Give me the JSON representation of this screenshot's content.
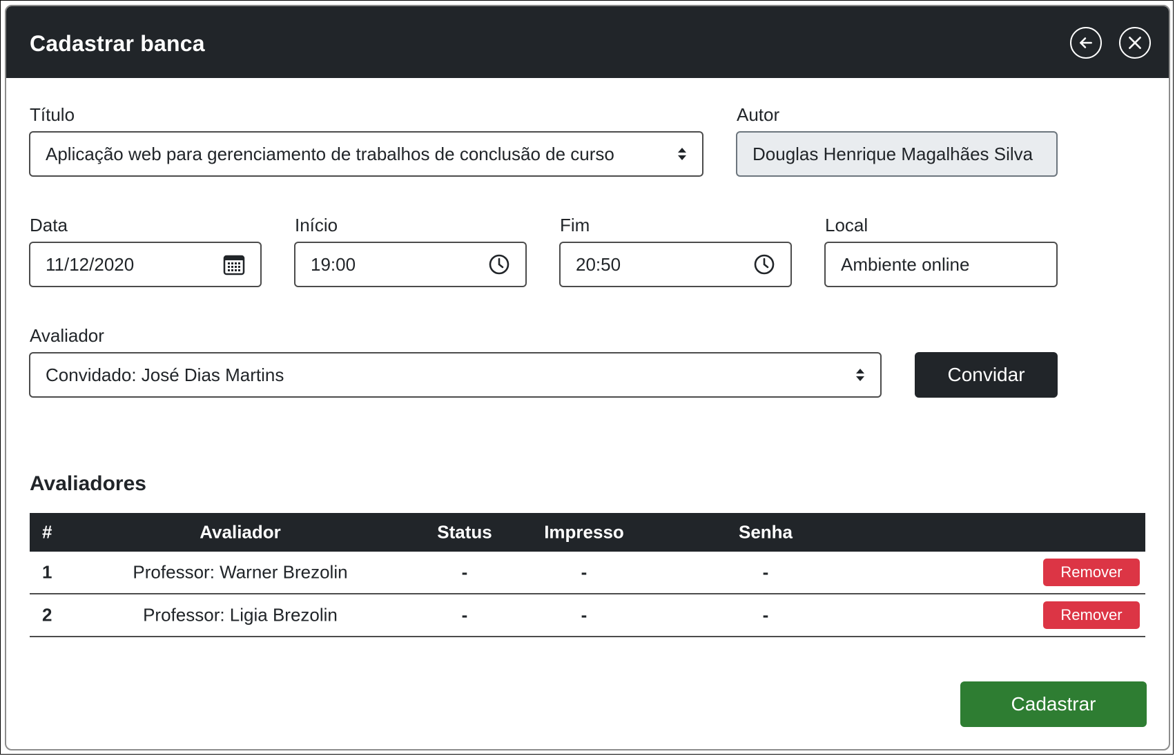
{
  "header": {
    "title": "Cadastrar banca",
    "back_icon": "arrow-left-circle-icon",
    "close_icon": "x-circle-icon"
  },
  "form": {
    "titulo": {
      "label": "Título",
      "value": "Aplicação web para gerenciamento de trabalhos de conclusão de curso"
    },
    "autor": {
      "label": "Autor",
      "value": "Douglas Henrique Magalhães Silva"
    },
    "data": {
      "label": "Data",
      "value": "11/12/2020"
    },
    "inicio": {
      "label": "Início",
      "value": "19:00"
    },
    "fim": {
      "label": "Fim",
      "value": "20:50"
    },
    "local": {
      "label": "Local",
      "value": "Ambiente online"
    },
    "avaliador": {
      "label": "Avaliador",
      "value": "Convidado: José Dias Martins"
    },
    "convidar_label": "Convidar"
  },
  "avaliadores": {
    "title": "Avaliadores",
    "columns": [
      "#",
      "Avaliador",
      "Status",
      "Impresso",
      "Senha"
    ],
    "rows": [
      {
        "num": "1",
        "avaliador": "Professor: Warner Brezolin",
        "status": "-",
        "impresso": "-",
        "senha": "-",
        "action": "Remover"
      },
      {
        "num": "2",
        "avaliador": "Professor: Ligia Brezolin",
        "status": "-",
        "impresso": "-",
        "senha": "-",
        "action": "Remover"
      }
    ]
  },
  "submit_label": "Cadastrar",
  "colors": {
    "dark": "#212529",
    "danger": "#dc3545",
    "success": "#2e7d32",
    "readonly_bg": "#e9ecef"
  }
}
